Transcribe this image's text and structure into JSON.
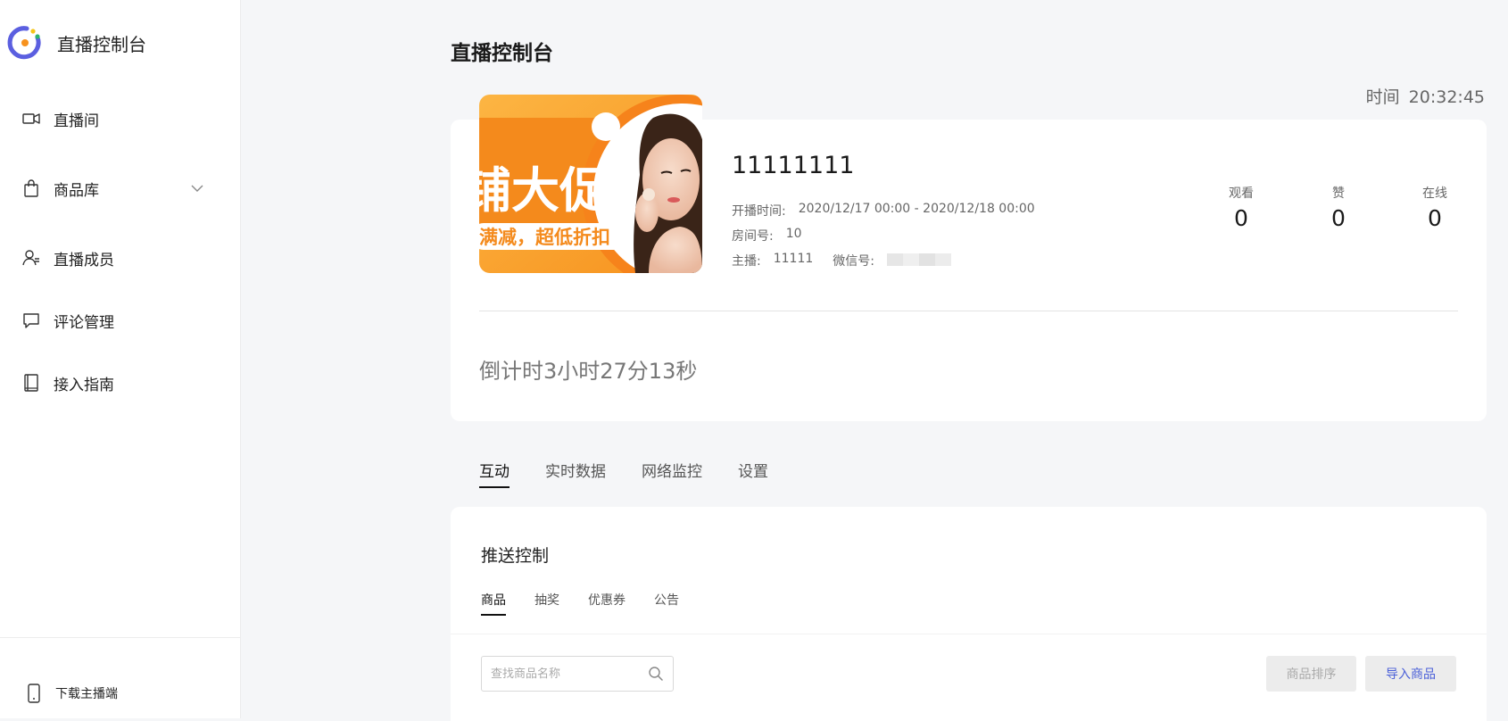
{
  "brand": {
    "title": "直播控制台",
    "logo_icon": "ring-logo-icon"
  },
  "sidebar": {
    "items": [
      {
        "label": "直播间",
        "icon": "video-camera-icon"
      },
      {
        "label": "商品库",
        "icon": "shopping-bag-icon",
        "has_children": true
      },
      {
        "label": "直播成员",
        "icon": "member-icon"
      },
      {
        "label": "评论管理",
        "icon": "comment-icon"
      },
      {
        "label": "接入指南",
        "icon": "book-icon"
      }
    ],
    "footer": {
      "label": "下载主播端",
      "icon": "phone-icon"
    }
  },
  "header": {
    "title": "直播控制台",
    "time_label": "时间",
    "time_value": "20:32:45"
  },
  "stream": {
    "cover_banner": {
      "main_text": "铺大促",
      "sub_text": "满减，超低折扣"
    },
    "name": "11111111",
    "start_label": "开播时间:",
    "start_value": "2020/12/17 00:00 - 2020/12/18 00:00",
    "room_label": "房间号:",
    "room_value": "10",
    "host_label": "主播:",
    "host_value": "11111",
    "wechat_label": "微信号:",
    "stats": [
      {
        "label": "观看",
        "value": "0"
      },
      {
        "label": "赞",
        "value": "0"
      },
      {
        "label": "在线",
        "value": "0"
      }
    ],
    "countdown": "倒计时3小时27分13秒"
  },
  "tabs": [
    {
      "label": "互动",
      "active": true
    },
    {
      "label": "实时数据",
      "active": false
    },
    {
      "label": "网络监控",
      "active": false
    },
    {
      "label": "设置",
      "active": false
    }
  ],
  "push_control": {
    "title": "推送控制",
    "subtabs": [
      {
        "label": "商品",
        "active": true
      },
      {
        "label": "抽奖",
        "active": false
      },
      {
        "label": "优惠券",
        "active": false
      },
      {
        "label": "公告",
        "active": false
      }
    ],
    "search_placeholder": "查找商品名称",
    "sort_button": "商品排序",
    "import_button": "导入商品"
  },
  "colors": {
    "accent": "#4a5fd8",
    "brand_orange": "#f7921e",
    "brand_purple": "#5b5fe0"
  }
}
